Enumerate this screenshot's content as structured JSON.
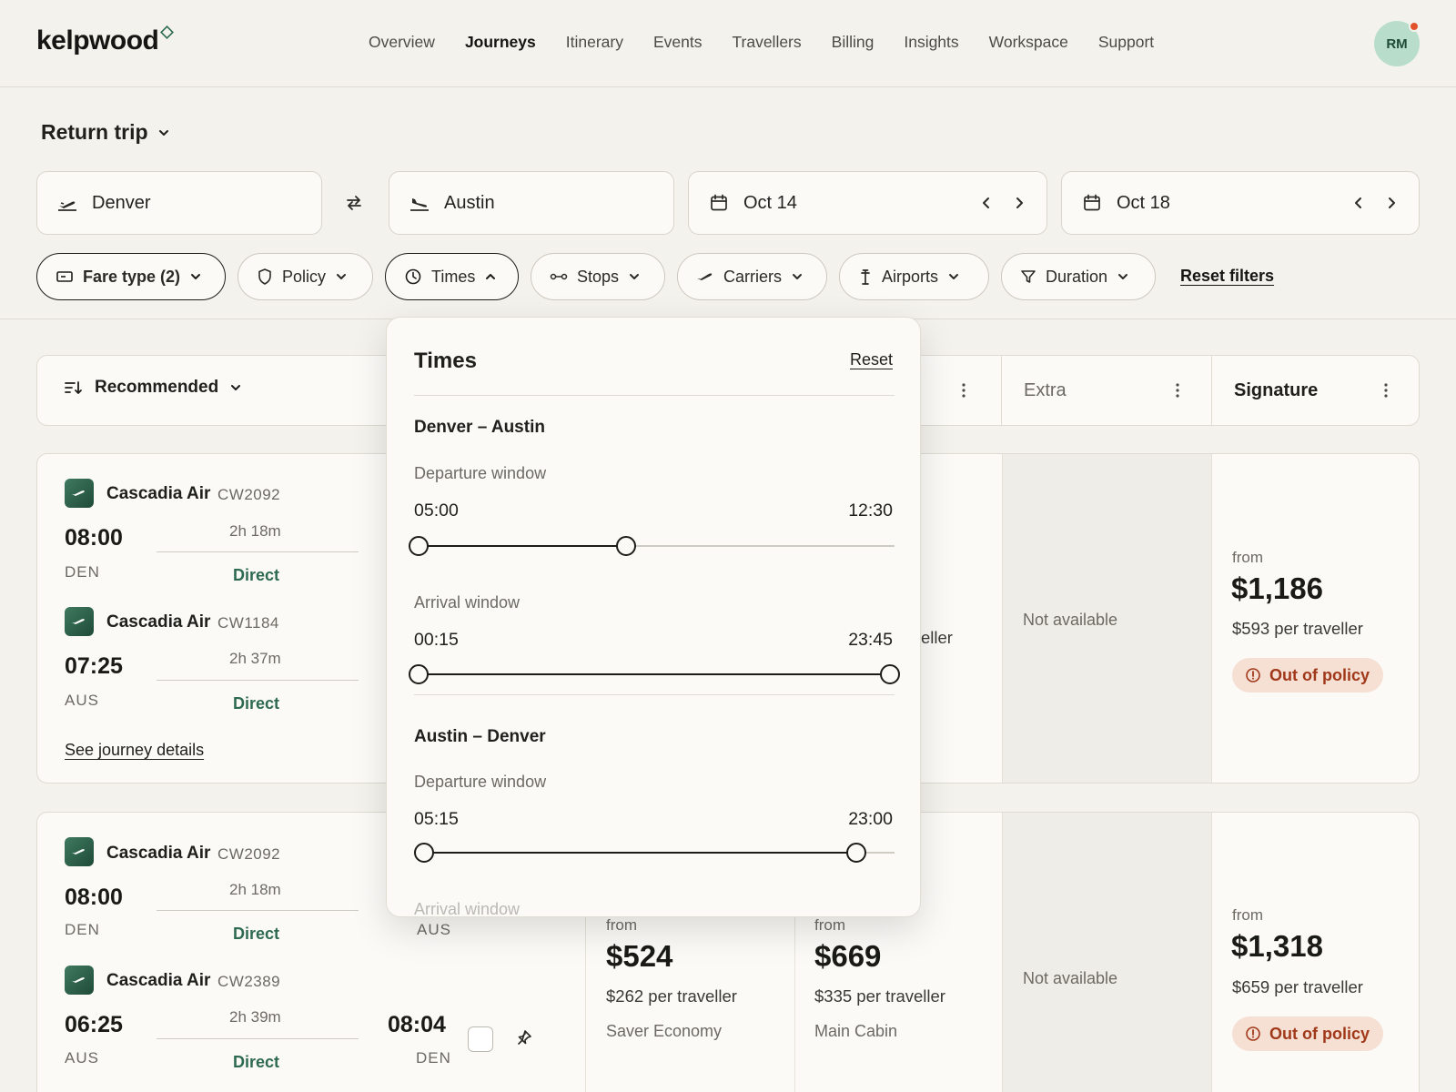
{
  "brand": {
    "name": "kelpwood",
    "accent": "#2d6a4f"
  },
  "nav": {
    "items": [
      "Overview",
      "Journeys",
      "Itinerary",
      "Events",
      "Travellers",
      "Billing",
      "Insights",
      "Workspace",
      "Support"
    ],
    "active": "Journeys"
  },
  "user": {
    "initials": "RM",
    "notification": true
  },
  "search": {
    "trip_type": "Return trip",
    "origin": "Denver",
    "destination": "Austin",
    "depart_date": "Oct 14",
    "return_date": "Oct 18"
  },
  "filters": {
    "fare_type": "Fare type (2)",
    "policy": "Policy",
    "times": "Times",
    "stops": "Stops",
    "carriers": "Carriers",
    "airports": "Airports",
    "duration": "Duration",
    "reset": "Reset filters"
  },
  "results_header": {
    "sort": "Recommended",
    "columns": [
      "Extra",
      "Signature"
    ]
  },
  "results": [
    {
      "outbound": {
        "airline": "Cascadia Air",
        "flight_no": "CW2092",
        "depart_time": "08:00",
        "depart_code": "DEN",
        "duration": "2h 18m",
        "stops": "Direct"
      },
      "inbound": {
        "airline": "Cascadia Air",
        "flight_no": "CW1184",
        "depart_time": "07:25",
        "depart_code": "AUS",
        "duration": "2h 37m",
        "stops": "Direct"
      },
      "details_link": "See journey details",
      "partial_fare_text": "eller",
      "extra": "Not available",
      "signature": {
        "from": "from",
        "price": "$1,186",
        "per_traveller": "$593 per traveller",
        "policy": "Out of policy"
      }
    },
    {
      "outbound": {
        "airline": "Cascadia Air",
        "flight_no": "CW2092",
        "depart_time": "08:00",
        "depart_code": "DEN",
        "duration": "2h 18m",
        "stops": "Direct",
        "arrive_code": "AUS"
      },
      "inbound": {
        "airline": "Cascadia Air",
        "flight_no": "CW2389",
        "depart_time": "06:25",
        "depart_code": "AUS",
        "duration": "2h 39m",
        "stops": "Direct",
        "arrive_time": "08:04",
        "arrive_code": "DEN"
      },
      "saver": {
        "from": "from",
        "price": "$524",
        "per_traveller": "$262 per traveller",
        "cabin": "Saver Economy"
      },
      "main": {
        "from": "from",
        "price": "$669",
        "per_traveller": "$335 per traveller",
        "cabin": "Main Cabin"
      },
      "extra": "Not available",
      "signature": {
        "from": "from",
        "price": "$1,318",
        "per_traveller": "$659 per traveller",
        "policy": "Out of policy"
      }
    }
  ],
  "times_popover": {
    "title": "Times",
    "reset": "Reset",
    "sections": [
      {
        "route": "Denver – Austin",
        "departure": {
          "label": "Departure window",
          "min": "05:00",
          "max": "12:30"
        },
        "arrival": {
          "label": "Arrival window",
          "min": "00:15",
          "max": "23:45"
        }
      },
      {
        "route": "Austin – Denver",
        "departure": {
          "label": "Departure window",
          "min": "05:15",
          "max": "23:00"
        },
        "arrival": {
          "label": "Arrival window"
        }
      }
    ]
  }
}
